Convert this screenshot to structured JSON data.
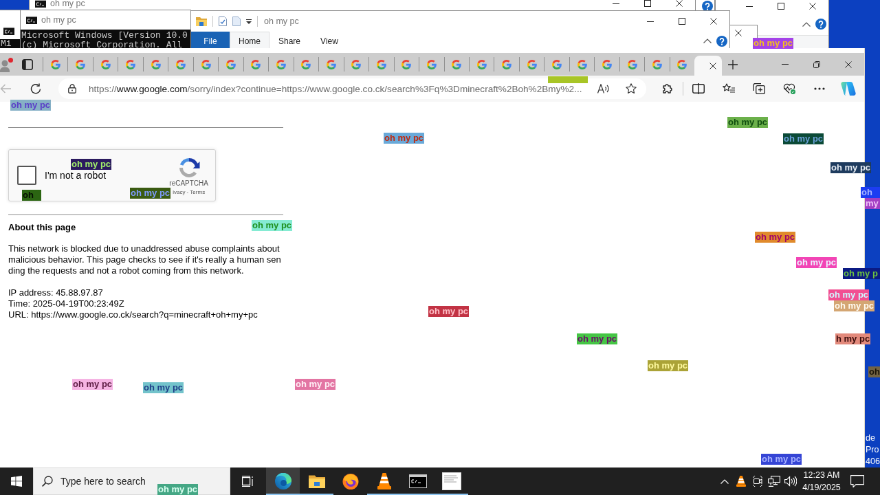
{
  "desktop": {
    "side_text": [
      "de",
      "Pro",
      "406"
    ]
  },
  "cmd_windows": [
    {
      "title": "oh my pc"
    },
    {
      "lines": [
        "Mi"
      ]
    },
    {
      "title": "oh my pc",
      "lines": [
        "Microsoft Windows [Version 10.0",
        "(c) Microsoft Corporation. All"
      ]
    }
  ],
  "explorer_window": {
    "title": "oh my pc",
    "ribbon_tabs": [
      {
        "label": "File",
        "kind": "menu",
        "selected": false
      },
      {
        "label": "Home",
        "kind": "tab",
        "selected": true
      },
      {
        "label": "Share",
        "kind": "tab",
        "selected": false
      },
      {
        "label": "View",
        "kind": "tab",
        "selected": false
      }
    ]
  },
  "browser": {
    "tabs": [
      {
        "selected": false
      },
      {
        "selected": false
      },
      {
        "selected": false
      },
      {
        "selected": false
      },
      {
        "selected": false
      },
      {
        "selected": false
      },
      {
        "selected": false
      },
      {
        "selected": false
      },
      {
        "selected": false
      },
      {
        "selected": false
      },
      {
        "selected": false
      },
      {
        "selected": false
      },
      {
        "selected": false
      },
      {
        "selected": false
      },
      {
        "selected": false
      },
      {
        "selected": false
      },
      {
        "selected": false
      },
      {
        "selected": false
      },
      {
        "selected": false
      },
      {
        "selected": false
      },
      {
        "selected": false
      },
      {
        "selected": false
      },
      {
        "selected": false
      },
      {
        "selected": false
      },
      {
        "selected": false
      },
      {
        "selected": false
      },
      {
        "selected": true
      }
    ],
    "back_disabled": true,
    "address": {
      "scheme": "https://",
      "host": "www.google.com",
      "path": "/sorry/index?continue=https://www.google.co.ck/search%3Fq%3Dminecraft%2Boh%2Bmy%2..."
    }
  },
  "page": {
    "captcha": {
      "label": "I'm not a robot",
      "checked": false,
      "brand": "reCAPTCHA",
      "links": "ivacy - Terms"
    },
    "about": {
      "heading": "About this page",
      "text": "This network is blocked due to unaddressed abuse complaints about malicious behavior. This page checks to see if it's really a human sending the requests and not a robot coming from this network.",
      "details": [
        "IP address: 45.88.97.87",
        "Time: 2025-04-19T00:23:49Z",
        "URL: https://www.google.co.ck/search?q=minecraft+oh+my+pc"
      ]
    }
  },
  "overlay_labels": [
    {
      "kind": "text",
      "text": "oh my pc",
      "color": "#a443e8"
    },
    {
      "kind": "blank",
      "color": "#a8c526"
    },
    {
      "kind": "text",
      "text": "oh my pc",
      "color": "#86b0c6"
    },
    {
      "kind": "text",
      "text": "oh my pc",
      "color": "#6bb04a"
    },
    {
      "kind": "text",
      "text": "oh my pc",
      "color": "#6aa9d8"
    },
    {
      "kind": "text",
      "text": "oh my pc",
      "color": "#0b4a37"
    },
    {
      "kind": "text",
      "text": "oh my pc",
      "color": "#2b1a5f"
    },
    {
      "kind": "text",
      "text": "oh my pc",
      "color": "#1e3b5e"
    },
    {
      "kind": "text",
      "text": "oh",
      "color": "#2b6512"
    },
    {
      "kind": "text",
      "text": "oh my pc",
      "color": "#3b5b12"
    },
    {
      "kind": "text",
      "text": "oh",
      "color": "#1d3df2"
    },
    {
      "kind": "text",
      "text": "my",
      "color": "#a43fc4"
    },
    {
      "kind": "text",
      "text": "oh my pc",
      "color": "#85ebd3"
    },
    {
      "kind": "text",
      "text": "oh my pc",
      "color": "#e08a2c"
    },
    {
      "kind": "text",
      "text": "oh my pc",
      "color": "#f245b5"
    },
    {
      "kind": "text",
      "text": "oh my p",
      "color": "#0b1a84"
    },
    {
      "kind": "text",
      "text": "oh my pc",
      "color": "#f24f92"
    },
    {
      "kind": "text",
      "text": "oh my pc",
      "color": "#d4a673"
    },
    {
      "kind": "text",
      "text": "oh my pc",
      "color": "#c23344"
    },
    {
      "kind": "text",
      "text": "oh my pc",
      "color": "#45c545"
    },
    {
      "kind": "text",
      "text": "h my pc",
      "color": "#e2897b"
    },
    {
      "kind": "text",
      "text": "oh my pc",
      "color": "#aba337"
    },
    {
      "kind": "text",
      "text": "oh",
      "color": "#736343"
    },
    {
      "kind": "text",
      "text": "oh my pc",
      "color": "#f5b3e3"
    },
    {
      "kind": "text",
      "text": "oh my pc",
      "color": "#73c3cb"
    },
    {
      "kind": "text",
      "text": "oh my pc",
      "color": "#e375a3"
    },
    {
      "kind": "text",
      "text": "oh my pc",
      "color": "#3545d5"
    },
    {
      "kind": "text",
      "text": "oh my pc",
      "color": "#45a785"
    }
  ],
  "taskbar": {
    "search": {
      "placeholder": "Type here to search"
    },
    "apps": [
      {
        "kind": "edge",
        "running": true,
        "selected": true
      },
      {
        "kind": "explorer",
        "running": true,
        "selected": false
      },
      {
        "kind": "firefox",
        "running": false,
        "selected": false
      },
      {
        "kind": "vlc",
        "running": true,
        "selected": false
      },
      {
        "kind": "cmd",
        "running": true,
        "selected": false
      },
      {
        "kind": "document",
        "running": true,
        "selected": false
      }
    ],
    "clock": {
      "time": "12:23 AM",
      "date": "4/19/2025"
    }
  }
}
